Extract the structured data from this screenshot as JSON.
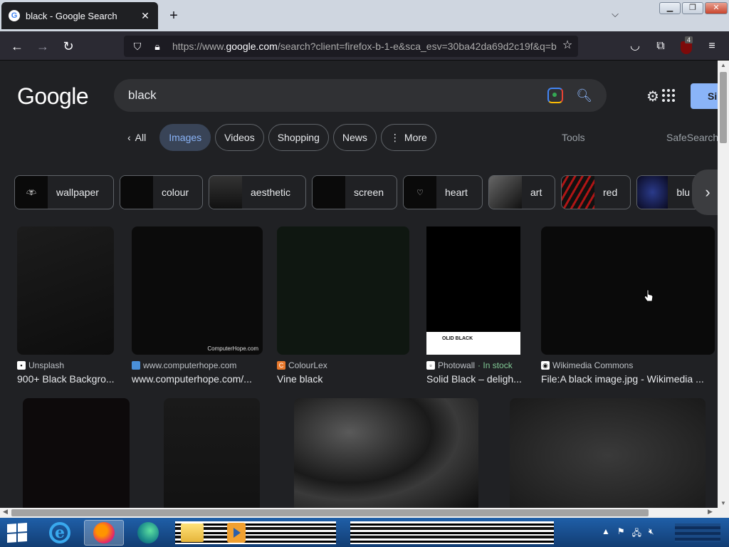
{
  "browser": {
    "tab_title": "black - Google Search",
    "tab_close": "✕",
    "new_tab": "+",
    "url_prefix": "https://www.",
    "url_domain": "google.com",
    "url_rest": "/search?client=firefox-b-1-e&sca_esv=30ba42da69d2c19f&q=b",
    "extension_badge": "4"
  },
  "google": {
    "logo": "Google",
    "query": "black",
    "signin_label": "Si",
    "tabs": [
      {
        "label": "All",
        "prefix": "‹"
      },
      {
        "label": "Images"
      },
      {
        "label": "Videos"
      },
      {
        "label": "Shopping"
      },
      {
        "label": "News"
      },
      {
        "label": "More",
        "prefix": "⋮"
      }
    ],
    "tools": "Tools",
    "safesearch": "SafeSearch",
    "related": [
      {
        "label": "wallpaper"
      },
      {
        "label": "colour"
      },
      {
        "label": "aesthetic"
      },
      {
        "label": "screen"
      },
      {
        "label": "heart"
      },
      {
        "label": "art"
      },
      {
        "label": "red"
      },
      {
        "label": "blu"
      }
    ],
    "results": [
      {
        "source": "Unsplash",
        "caption": "900+ Black Backgro..."
      },
      {
        "source": "www.computerhope.com",
        "caption": "www.computerhope.com/...",
        "watermark": "ComputerHope.com"
      },
      {
        "source": "ColourLex",
        "caption": "Vine black"
      },
      {
        "source": "Photowall",
        "stock": "· In stock",
        "caption": "Solid Black – deligh...",
        "strip": "OLID BLACK"
      },
      {
        "source": "Wikimedia Commons",
        "caption": "File:A black image.jpg - Wikimedia ..."
      }
    ]
  },
  "colors": {
    "background": "#202124",
    "accent": "#8ab4f8",
    "active_chip": "#394457"
  }
}
